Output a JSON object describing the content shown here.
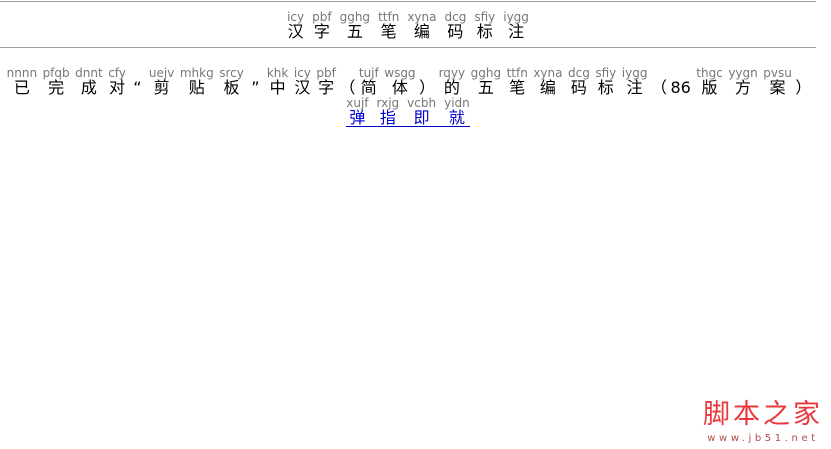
{
  "title": {
    "units": [
      {
        "code": "icy",
        "char": "汉"
      },
      {
        "code": "pbf",
        "char": "字"
      },
      {
        "code": "gghg",
        "char": "五"
      },
      {
        "code": "ttfn",
        "char": "笔"
      },
      {
        "code": "xyna",
        "char": "编"
      },
      {
        "code": "dcg",
        "char": "码"
      },
      {
        "code": "sfiy",
        "char": "标"
      },
      {
        "code": "iygg",
        "char": "注"
      }
    ]
  },
  "result": {
    "tokens": [
      {
        "code": "nnnn",
        "char": "已"
      },
      {
        "code": "pfqb",
        "char": "完"
      },
      {
        "code": "dnnt",
        "char": "成"
      },
      {
        "code": "cfy",
        "char": "对"
      },
      {
        "char": "“"
      },
      {
        "code": "uejv",
        "char": "剪"
      },
      {
        "code": "mhkg",
        "char": "贴"
      },
      {
        "code": "srcy",
        "char": "板"
      },
      {
        "char": "”"
      },
      {
        "code": "khk",
        "char": "中"
      },
      {
        "code": "icy",
        "char": "汉"
      },
      {
        "code": "pbf",
        "char": "字"
      },
      {
        "char": "（"
      },
      {
        "code": "tujf",
        "char": "简"
      },
      {
        "code": "wsgg",
        "char": "体"
      },
      {
        "char": "）"
      },
      {
        "code": "rqyy",
        "char": "的"
      },
      {
        "code": "gghg",
        "char": "五"
      },
      {
        "code": "ttfn",
        "char": "笔"
      },
      {
        "code": "xyna",
        "char": "编"
      },
      {
        "code": "dcg",
        "char": "码"
      },
      {
        "code": "sfiy",
        "char": "标"
      },
      {
        "code": "iygg",
        "char": "注"
      },
      {
        "char": "（"
      },
      {
        "char": "86"
      },
      {
        "code": "thgc",
        "char": "版"
      },
      {
        "code": "yygn",
        "char": "方"
      },
      {
        "code": "pvsu",
        "char": "案"
      },
      {
        "char": "）"
      }
    ],
    "link": {
      "units": [
        {
          "code": "xujf",
          "char": "弹"
        },
        {
          "code": "rxjg",
          "char": "指"
        },
        {
          "code": "vcbh",
          "char": "即"
        },
        {
          "code": "yidn",
          "char": "就"
        }
      ]
    }
  },
  "logo": {
    "name": "脚本之家",
    "url": "www.jb51.net"
  },
  "colors": {
    "code": "#777777",
    "hanzi": "#000000",
    "link": "#0000cc",
    "rule": "#a0a0a0",
    "logo": "#e8383d",
    "logo-url": "#b84a4a"
  }
}
